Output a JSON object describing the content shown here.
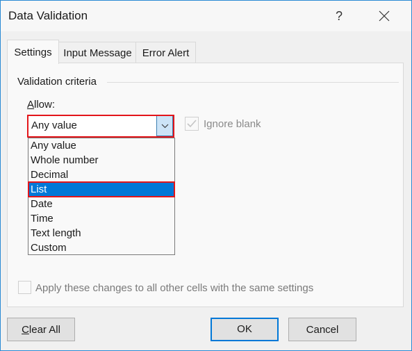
{
  "window": {
    "title": "Data Validation",
    "help_label": "?",
    "close_icon": "close-icon"
  },
  "tabs": [
    {
      "label": "Settings",
      "active": true
    },
    {
      "label": "Input Message",
      "active": false
    },
    {
      "label": "Error Alert",
      "active": false
    }
  ],
  "settings": {
    "group_label": "Validation criteria",
    "allow_label_mnemonic": "A",
    "allow_label_rest": "llow:",
    "allow_value": "Any value",
    "allow_options": [
      "Any value",
      "Whole number",
      "Decimal",
      "List",
      "Date",
      "Time",
      "Text length",
      "Custom"
    ],
    "highlighted_option": "List",
    "ignore_blank": {
      "label": "Ignore blank",
      "checked": true,
      "enabled": false
    },
    "apply_all": {
      "label": "Apply these changes to all other cells with the same settings",
      "checked": false,
      "enabled": false
    }
  },
  "buttons": {
    "clear_all_mnemonic": "C",
    "clear_all_rest": "lear All",
    "ok": "OK",
    "cancel": "Cancel"
  },
  "colors": {
    "highlight_outline": "#e3151a",
    "selection": "#0078d7",
    "window_border": "#2a8ad4"
  }
}
